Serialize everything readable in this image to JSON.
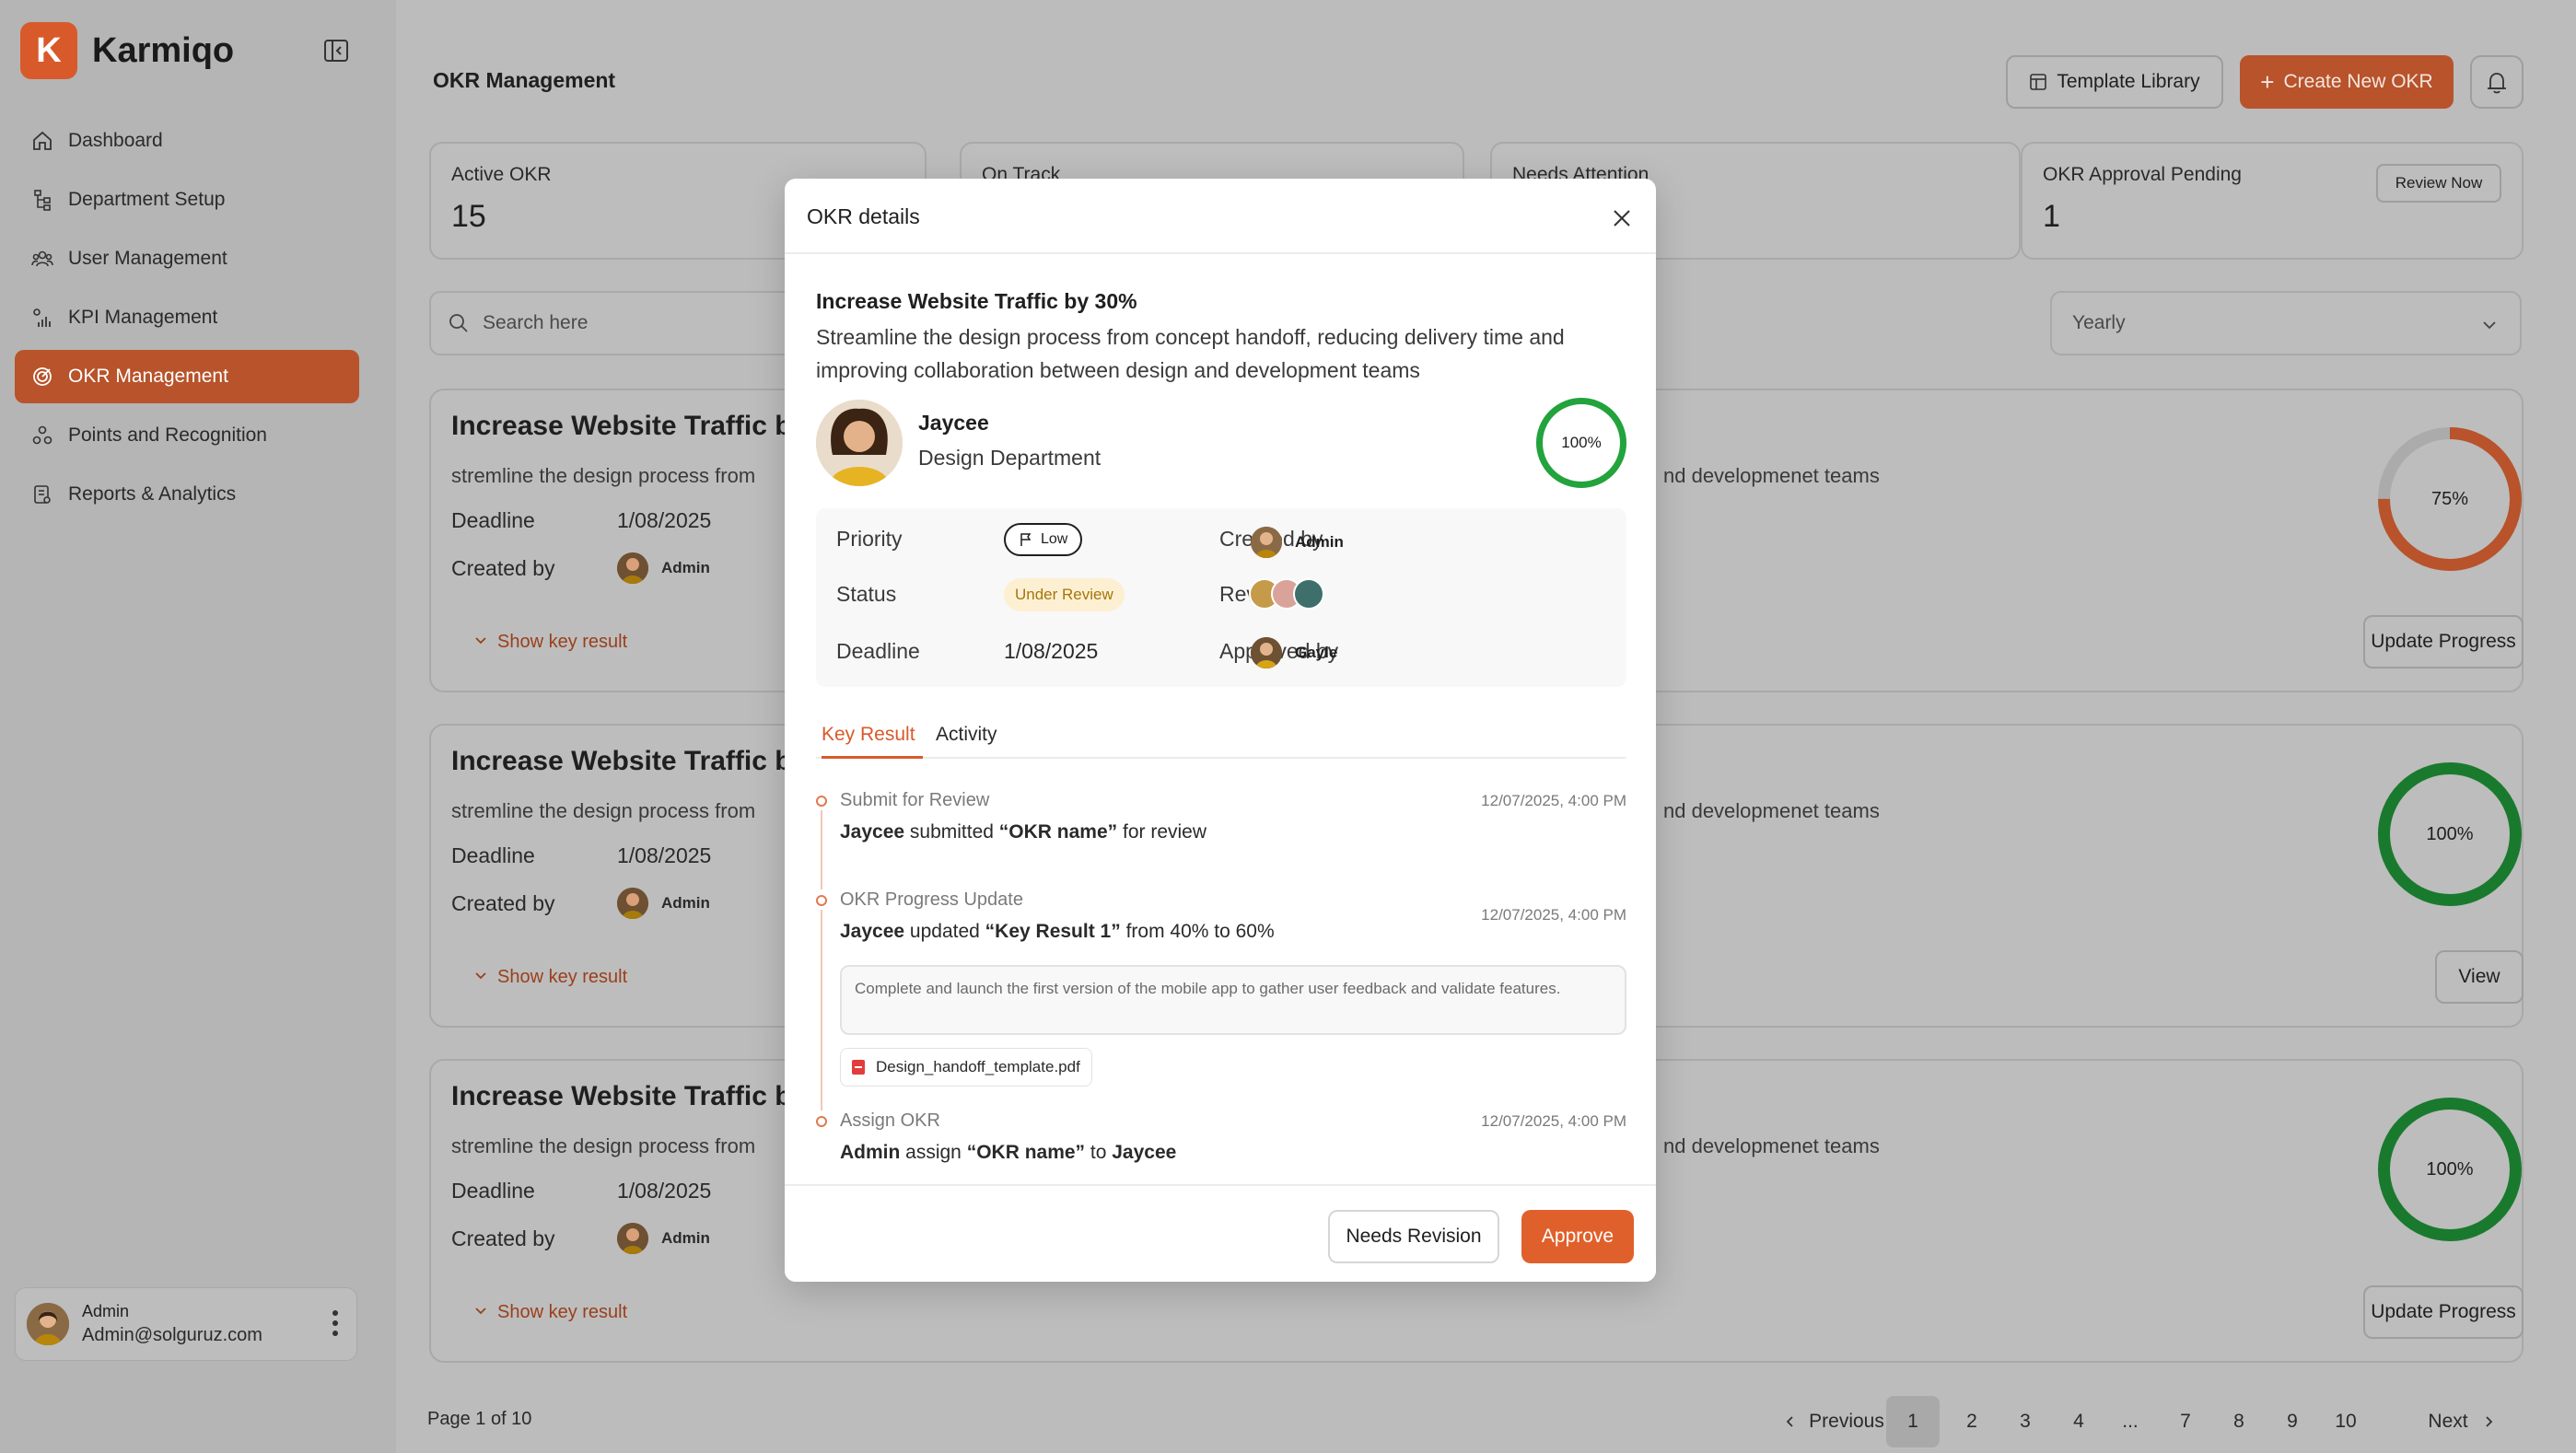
{
  "app": {
    "name": "Karmiqo",
    "logo_letter": "K"
  },
  "sidebar": {
    "items": [
      {
        "label": "Dashboard",
        "icon": "home-icon"
      },
      {
        "label": "Department Setup",
        "icon": "org-tree-icon"
      },
      {
        "label": "User Management",
        "icon": "users-icon"
      },
      {
        "label": "KPI Management",
        "icon": "kpi-chart-icon"
      },
      {
        "label": "OKR Management",
        "icon": "target-icon",
        "active": true
      },
      {
        "label": "Points and Recognition",
        "icon": "award-icon"
      },
      {
        "label": "Reports & Analytics",
        "icon": "report-icon"
      }
    ],
    "user": {
      "name": "Admin",
      "email": "Admin@solguruz.com"
    }
  },
  "header": {
    "title": "OKR Management",
    "template_library": "Template Library",
    "create_new": "Create New OKR"
  },
  "stats": [
    {
      "label": "Active OKR",
      "value": "15"
    },
    {
      "label": "On Track",
      "value": ""
    },
    {
      "label": "Needs Attention",
      "value": ""
    },
    {
      "label": "OKR Approval Pending",
      "value": "1",
      "action": "Review Now"
    }
  ],
  "filters": {
    "search_placeholder": "Search here",
    "period": "Yearly"
  },
  "cards": [
    {
      "title": "Increase Website Traffic by",
      "desc_left": "stremline the design process from",
      "desc_right": "nd developmenet teams",
      "deadline_label": "Deadline",
      "deadline": "1/08/2025",
      "created_label": "Created by",
      "created_by": "Admin",
      "show_kr": "Show key result",
      "progress": 75,
      "progress_label": "75%",
      "progress_color": "#b8532b",
      "action": "Update Progress"
    },
    {
      "title": "Increase Website Traffic by",
      "desc_left": "stremline the design process from",
      "desc_right": "nd developmenet teams",
      "deadline_label": "Deadline",
      "deadline": "1/08/2025",
      "created_label": "Created by",
      "created_by": "Admin",
      "show_kr": "Show key result",
      "progress": 100,
      "progress_label": "100%",
      "progress_color": "#197a2e",
      "action": "View"
    },
    {
      "title": "Increase Website Traffic by",
      "desc_left": "stremline the design process from",
      "desc_right": "nd developmenet teams",
      "deadline_label": "Deadline",
      "deadline": "1/08/2025",
      "created_label": "Created by",
      "created_by": "Admin",
      "show_kr": "Show key result",
      "progress": 100,
      "progress_label": "100%",
      "progress_color": "#197a2e",
      "action": "Update Progress"
    }
  ],
  "pagination": {
    "info": "Page 1 of 10",
    "previous": "Previous",
    "next": "Next",
    "pages": [
      "1",
      "2",
      "3",
      "4",
      "...",
      "7",
      "8",
      "9",
      "10"
    ],
    "current": "1"
  },
  "modal": {
    "title": "OKR details",
    "okr_title": "Increase Website Traffic by 30%",
    "okr_desc": "Streamline the design process from concept handoff, reducing delivery time and improving collaboration between design and development teams",
    "owner_name": "Jaycee",
    "owner_dept": "Design Department",
    "progress": 100,
    "progress_label": "100%",
    "progress_color": "#22a33c",
    "info": {
      "priority_label": "Priority",
      "priority": "Low",
      "status_label": "Status",
      "status": "Under Review",
      "deadline_label": "Deadline",
      "deadline": "1/08/2025",
      "created_label": "Created by",
      "created_by": "Admin",
      "reviewer_label": "Reviewer",
      "approved_label": "Approved by",
      "approved_by": "Gayle"
    },
    "tabs": [
      "Key Result",
      "Activity"
    ],
    "activity": [
      {
        "title": "Submit for Review",
        "time": "12/07/2025, 4:00 PM",
        "actor": "Jaycee",
        "verb": " submitted ",
        "object": "“OKR name”",
        "tail": " for review"
      },
      {
        "title": "OKR Progress Update",
        "time": "12/07/2025, 4:00 PM",
        "actor": "Jaycee",
        "verb": " updated ",
        "object": "“Key Result 1”",
        "tail": " from 40% to 60%",
        "note": "Complete and launch the first version of the mobile app to gather user feedback and validate features.",
        "file": "Design_handoff_template.pdf"
      },
      {
        "title": "Assign OKR",
        "time": "12/07/2025, 4:00 PM",
        "actor": "Admin",
        "verb": " assign ",
        "object": "“OKR name”",
        "tail": " to ",
        "target": "Jaycee"
      }
    ],
    "needs_revision": "Needs Revision",
    "approve": "Approve"
  }
}
